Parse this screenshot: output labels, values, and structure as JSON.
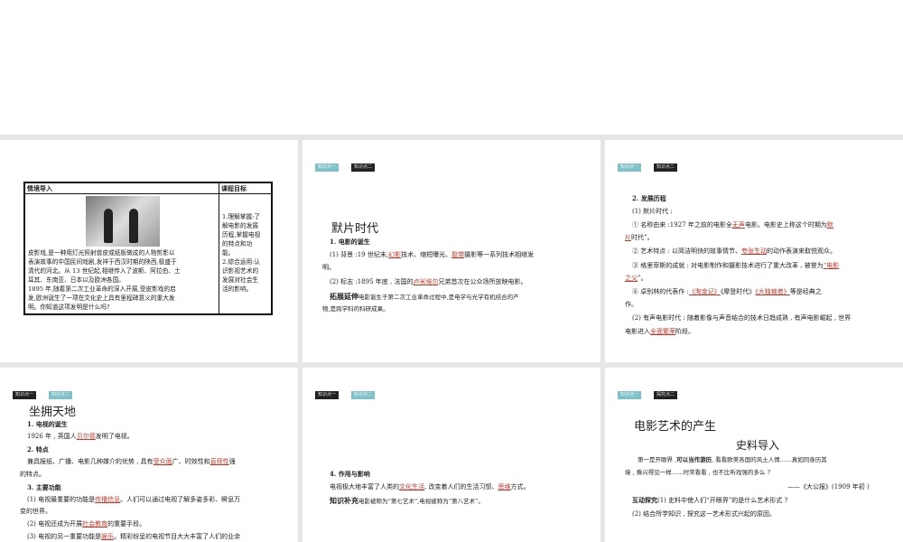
{
  "slide1": {
    "header_left": "情境导入",
    "header_right": "课程目标",
    "left_lines": [
      "皮影戏,是一种用灯光照射兽皮或纸板做成的人物剪影以",
      "表演故事的中国民间戏剧,发祥于西汉时期的陕西,极盛于",
      "清代的河北。从 13 世纪起,相继传入了波斯、阿拉伯、土",
      "耳其、东南亚、日本以及欧洲各国。",
      "1895 年,随着第二次工业革命的深入开展,受皮影戏的启",
      "发,欧洲诞生了一项在文化史上具有里程碑意义的重大发",
      "明。你知道这项发明是什么吗?"
    ],
    "right_lines": [
      "1.理解掌握:了",
      "解电影的发展",
      "历程,掌握电视",
      "的特点和功",
      "能。",
      "2.综合运用:认",
      "识影视艺术的",
      "发展对社会生",
      "活的影响。"
    ]
  },
  "slide2": {
    "tag1": "知识点一",
    "tag2": "知识点二",
    "title": "默片时代",
    "sub": "1. 电影的诞生",
    "l1a": "(1) 背景 :19 世纪末,",
    "l1r1": "幻影",
    "l1b": "技术、缩短曝光、",
    "l1r2": "胶带",
    "l1c": "摄影等一系列技术相继发",
    "l1d": "明。",
    "l2a": "(2) 标志 :1895 年底 , 法国的",
    "l2r": "卢米埃尔",
    "l2b": "兄弟首次在公众场所放映电影。",
    "ext_label": "拓展延伸",
    "ext1": "电影诞生于第二次工业革命过程中,是电学与光学有机结合的产",
    "ext2": "物,是跨学科的科研成果。"
  },
  "slide3": {
    "tag1": "知识点一",
    "tag2": "知识点二",
    "h": "2. 发展历程",
    "a": "(1) 默片时代 :",
    "b1": "① 名称由来 :1927 年之前的电影全",
    "b1r": "无声",
    "b1b": "电影。电影史上称这个时期为",
    "b1r2": "默",
    "b2r": "片",
    "b2": "时代”。",
    "c1": "② 艺术特点 : 以简洁明快的故事情节、",
    "c1r": "夸张生动",
    "c1b": "的动作表演来取悦观众。",
    "d1": "③ 格里菲斯的成就 : 对电影制作和摄影技术进行了重大改革 , 被誉为",
    "d1r": "“电影",
    "d2r": "之父",
    "d2": "”。",
    "e1": "④ 卓别林的代表作 :",
    "e1r": "《淘金记》",
    "e1b": "《摩登时代》",
    "e1r2": "《大独裁者》",
    "e1c": "等是经典之",
    "e2": "作。",
    "f1": "(2) 有声电影时代 : 随着影像与声音结合的技术日趋成熟 , 有声电影崛起 , 世界",
    "f2a": "电影进入",
    "f2r": "全面繁荣",
    "f2b": "阶段。"
  },
  "slide4": {
    "tag1": "知识点一",
    "tag2": "知识点二",
    "title": "坐拥天地",
    "s1": "1. 电视的诞生",
    "s1l": "1926 年 , 英国人",
    "s1r": "贝尔德",
    "s1b": "发明了电视。",
    "s2": "2. 特点",
    "s2l": "兼具报纸、广播、电影几种媒介的优势 , 具有",
    "s2r": "受众面",
    "s2b": "广、时效性和",
    "s2r2": "直观性",
    "s2c": "强",
    "s2d": "的特点。",
    "s3": "3. 主要功能",
    "s3a": "(1) 电视最重要的功能是",
    "s3ar": "传播信息",
    "s3ab": "。人们可以通过电视了解多姿多彩、瞬息万",
    "s3ac": "变的世界。",
    "s3b": "(2) 电视还成为开展",
    "s3br": "社会教育",
    "s3bb": "的重要手段。",
    "s3c": "(3) 电视的另一重要功能是",
    "s3cr": "娱乐",
    "s3cb": "。精彩纷呈的电视节目大大丰富了人们的业余"
  },
  "slide5": {
    "tag1": "知识点一",
    "tag2": "知识点二",
    "s4": "4. 作用与影响",
    "l1": "电视极大地丰富了人类的",
    "l1r": "文化生活",
    "l1b": ", 改变着人们的生活习惯、",
    "l1r2": "思维",
    "l1c": "方式。",
    "sup_label": "知识补充",
    "sup": "电影被称为“第七艺术”,电视被称为“第八艺术”。"
  },
  "slide6": {
    "tag1": "知识点一",
    "tag2": "探究点二",
    "title": "电影艺术的产生",
    "subtitle": "史料导入",
    "q1a": "第一是开眼界 ,",
    "q1b": "可以当作游历",
    "q1c": ", 看看欧美各国的风土人情……真如同身历其",
    "q2": "境 , 乘兴得见一样……时常看看 , 也不比听戏强的多么 ?",
    "cite": "——《大公报》(1909 年初 )",
    "ex_label": "互动探究",
    "ex1": "(1) 史料中使人们“开眼界”的是什么艺术形式 ?",
    "ex2": "(2) 结合所学知识 , 探究这一艺术形式兴起的原因。"
  }
}
